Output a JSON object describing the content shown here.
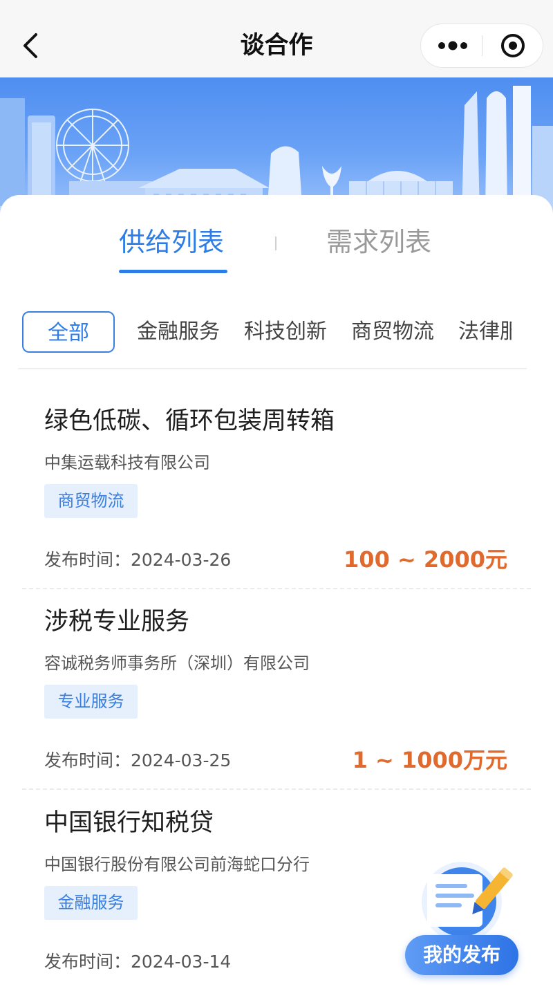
{
  "nav": {
    "title": "谈合作"
  },
  "tabs": [
    {
      "label": "供给列表",
      "active": true
    },
    {
      "label": "需求列表",
      "active": false
    }
  ],
  "categories": [
    {
      "label": "全部",
      "active": true
    },
    {
      "label": "金融服务",
      "active": false
    },
    {
      "label": "科技创新",
      "active": false
    },
    {
      "label": "商贸物流",
      "active": false
    },
    {
      "label": "法律服务",
      "active": false
    }
  ],
  "items": [
    {
      "title": "绿色低碳、循环包装周转箱",
      "company": "中集运载科技有限公司",
      "tag": "商贸物流",
      "date": "发布时间：2024-03-26",
      "price": "100 ~ 2000元"
    },
    {
      "title": "涉税专业服务",
      "company": "容诚税务师事务所（深圳）有限公司",
      "tag": "专业服务",
      "date": "发布时间：2024-03-25",
      "price": "1 ~ 1000万元"
    },
    {
      "title": "中国银行知税贷",
      "company": "中国银行股份有限公司前海蛇口分行",
      "tag": "金融服务",
      "date": "发布时间：2024-03-14",
      "price": ""
    }
  ],
  "fab": {
    "label": "我的发布"
  },
  "colors": {
    "accent": "#2e7de6",
    "price": "#e06a2d",
    "tag_bg": "#e6f0fd",
    "banner": "#4f8ef0"
  }
}
